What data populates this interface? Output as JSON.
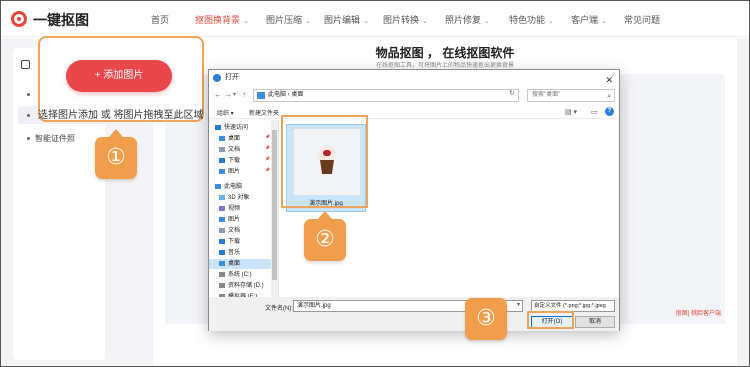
{
  "header": {
    "brand": "一键抠图",
    "nav": [
      {
        "label": "首页",
        "caret": false
      },
      {
        "label": "抠图换背景",
        "caret": true,
        "active": true
      },
      {
        "label": "图片压缩",
        "caret": true
      },
      {
        "label": "图片编辑",
        "caret": true
      },
      {
        "label": "图片转换",
        "caret": true
      },
      {
        "label": "照片修复",
        "caret": true
      },
      {
        "label": "特色功能",
        "caret": true
      },
      {
        "label": "客户端",
        "caret": true
      },
      {
        "label": "常见问题",
        "caret": false
      }
    ]
  },
  "sidebar": {
    "item_label": "智能证件照"
  },
  "main": {
    "title": "物品抠图 ， 在线抠图软件",
    "subtitle": "在线抠图工具，可将图片上的物品快速抠出更换背景",
    "bottom_link": "抠图] 桃脸客户端"
  },
  "upload": {
    "button_label": "+ 添加图片",
    "hint": "选择图片添加 或 将图片拖拽至此区域"
  },
  "steps": [
    "①",
    "②",
    "③"
  ],
  "dialog": {
    "title": "打开",
    "close": "✕",
    "path": "此电脑  ›  桌面",
    "search_placeholder": "搜索\"桌面\"",
    "toolbar": {
      "organize": "组织 ▾",
      "new_folder": "新建文件夹"
    },
    "tree": [
      {
        "label": "快速访问",
        "icon": "star-icon",
        "pin": false
      },
      {
        "label": "桌面",
        "icon": "desktop-icon",
        "pin": true
      },
      {
        "label": "文档",
        "icon": "document-icon",
        "pin": true
      },
      {
        "label": "下载",
        "icon": "download-icon",
        "pin": true
      },
      {
        "label": "图片",
        "icon": "picture-icon",
        "pin": true
      },
      {
        "label": "此电脑",
        "icon": "computer-icon",
        "pin": false
      },
      {
        "label": "3D 对象",
        "icon": "cube-icon",
        "pin": false
      },
      {
        "label": "视频",
        "icon": "video-icon",
        "pin": false
      },
      {
        "label": "图片",
        "icon": "picture-icon",
        "pin": false
      },
      {
        "label": "文档",
        "icon": "document-icon",
        "pin": false
      },
      {
        "label": "下载",
        "icon": "download-icon",
        "pin": false
      },
      {
        "label": "音乐",
        "icon": "music-icon",
        "pin": false
      },
      {
        "label": "桌面",
        "icon": "desktop-icon",
        "pin": false,
        "selected": true
      },
      {
        "label": "系统 (C:)",
        "icon": "drive-icon",
        "pin": false
      },
      {
        "label": "资料存储 (D:)",
        "icon": "drive-icon",
        "pin": false
      },
      {
        "label": "模拟器 (E:)",
        "icon": "drive-icon",
        "pin": false
      }
    ],
    "file": {
      "name": "演示图片.jpg"
    },
    "filename_label": "文件名(N):",
    "filename_value": "演示图片.jpg",
    "filetype": "自定义文件 (*.png;*.jpg;*.jpeg",
    "open_label": "打开(O)",
    "cancel_label": "取消"
  },
  "colors": {
    "accent": "#e9453b",
    "callout": "#f0a35a",
    "step": "#f19e4c",
    "select": "#cce4f7"
  }
}
